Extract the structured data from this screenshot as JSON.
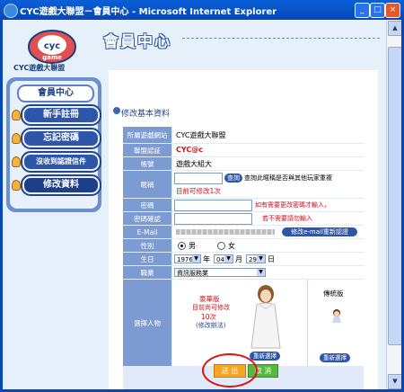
{
  "window": {
    "title": "CYC遊戲大聯盟－會員中心 - Microsoft Internet Explorer",
    "controls": [
      "_",
      "□",
      "×"
    ]
  },
  "logo": {
    "text": "CYC遊戲大聯盟",
    "mark": "CYC game"
  },
  "heading": "會員中心",
  "sidebar": {
    "title": "會員中心",
    "items": [
      {
        "label": "新手註冊"
      },
      {
        "label": "忘記密碼"
      },
      {
        "label": "沒收到認證信件"
      },
      {
        "label": "修改資料"
      }
    ]
  },
  "section_title": "修改基本資料",
  "form": {
    "site": {
      "label": "所屬遊戲網站",
      "value": "CYC遊戲大聯盟"
    },
    "group": {
      "label": "聯盟認証",
      "value": "CYC@c"
    },
    "account": {
      "label": "帳號",
      "value": "遊戲大組大"
    },
    "nickname": {
      "label": "暱稱",
      "check_button": "查詢",
      "hint": "查詢此暱稱是否與其他玩家重複",
      "remaining": "目前可修改1次"
    },
    "password": {
      "label": "密碼",
      "hint": "如有需要更改密碼才輸入，"
    },
    "password_confirm": {
      "label": "密碼確認",
      "hint": "若不需要請勿輸入"
    },
    "email": {
      "label": "E-Mail",
      "button": "修改e-mail重新認證"
    },
    "gender": {
      "label": "性別",
      "options": [
        "男",
        "女"
      ],
      "selected": "男"
    },
    "birthday": {
      "label": "生日",
      "year": "1976",
      "year_unit": "年",
      "month": "04",
      "month_unit": "月",
      "day": "29",
      "day_unit": "日"
    },
    "occupation": {
      "label": "職業",
      "value": "資訊服務業"
    },
    "character": {
      "label": "選擇人物",
      "deluxe_title": "豪華版",
      "deluxe_line1": "目前尚可修改",
      "deluxe_count": "10次",
      "deluxe_note": "(修改辦法)",
      "reselect_button": "重新選擇",
      "classic_title": "傳統版",
      "classic_reselect_button": "重新選擇"
    }
  },
  "actions": {
    "submit": "送 出",
    "cancel": "取 消"
  },
  "colors": {
    "titlebar": "#0847b8",
    "accent": "#2e56a8",
    "label_bg": "#7d9bd3",
    "warning": "#d0101a",
    "submit": "#f5a623",
    "cancel": "#5ab840"
  }
}
